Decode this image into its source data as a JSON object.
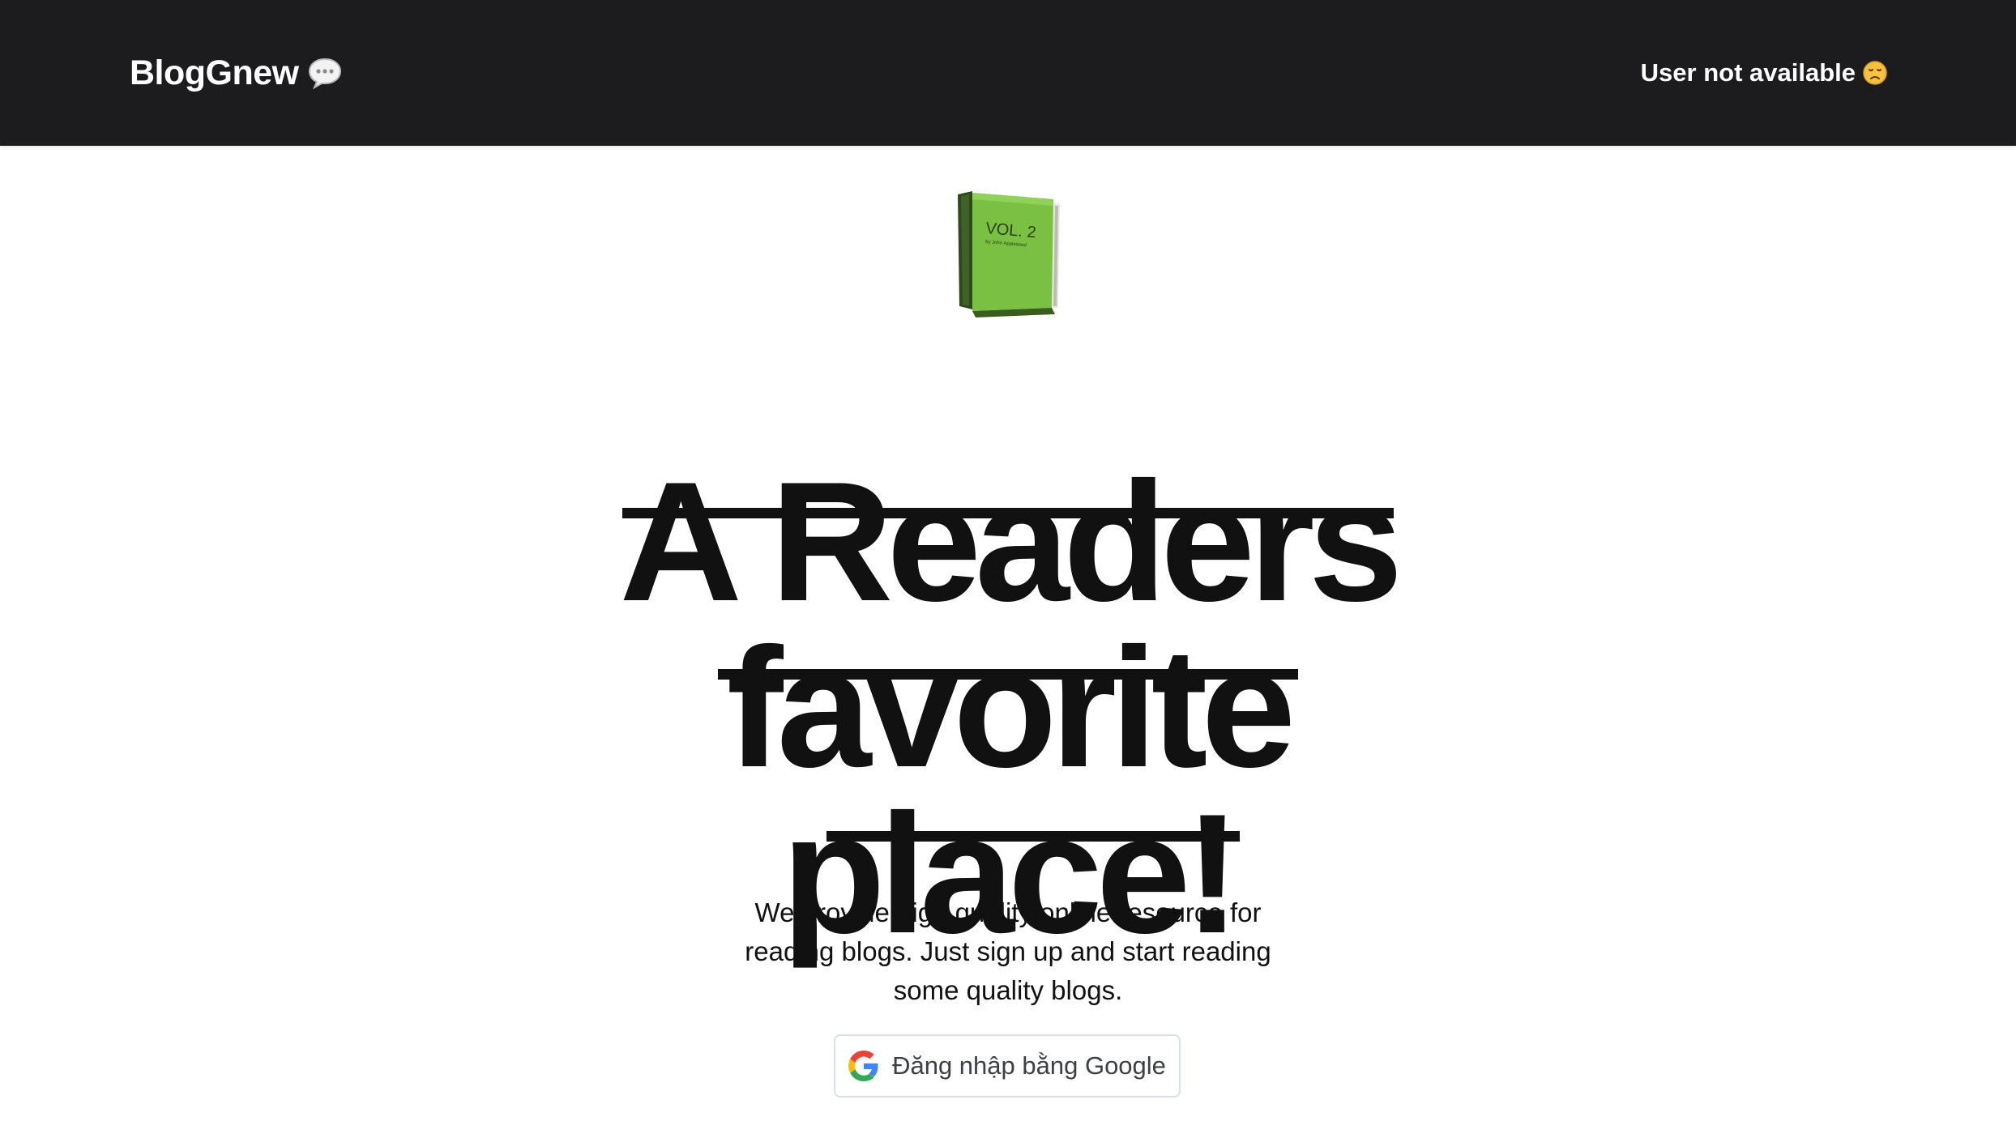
{
  "header": {
    "brand": "BlogGnew",
    "brand_icon": "speech-bubble-icon",
    "user_status": "User not available",
    "user_status_icon": "sad-face-icon",
    "background_color": "#1c1c1e"
  },
  "hero": {
    "illustration_icon": "green-book-icon",
    "headline_lines": [
      "A Readers",
      "favorite",
      "place!"
    ],
    "tagline": "We provide high quality online resource for reading blogs. Just sign up and start reading some quality blogs.",
    "login_button": {
      "label": "Đăng nhập bằng Google",
      "icon": "google-g-icon"
    }
  },
  "colors": {
    "text": "#111111",
    "button_border": "#d7e0ea",
    "book_green": "#7ac143"
  }
}
